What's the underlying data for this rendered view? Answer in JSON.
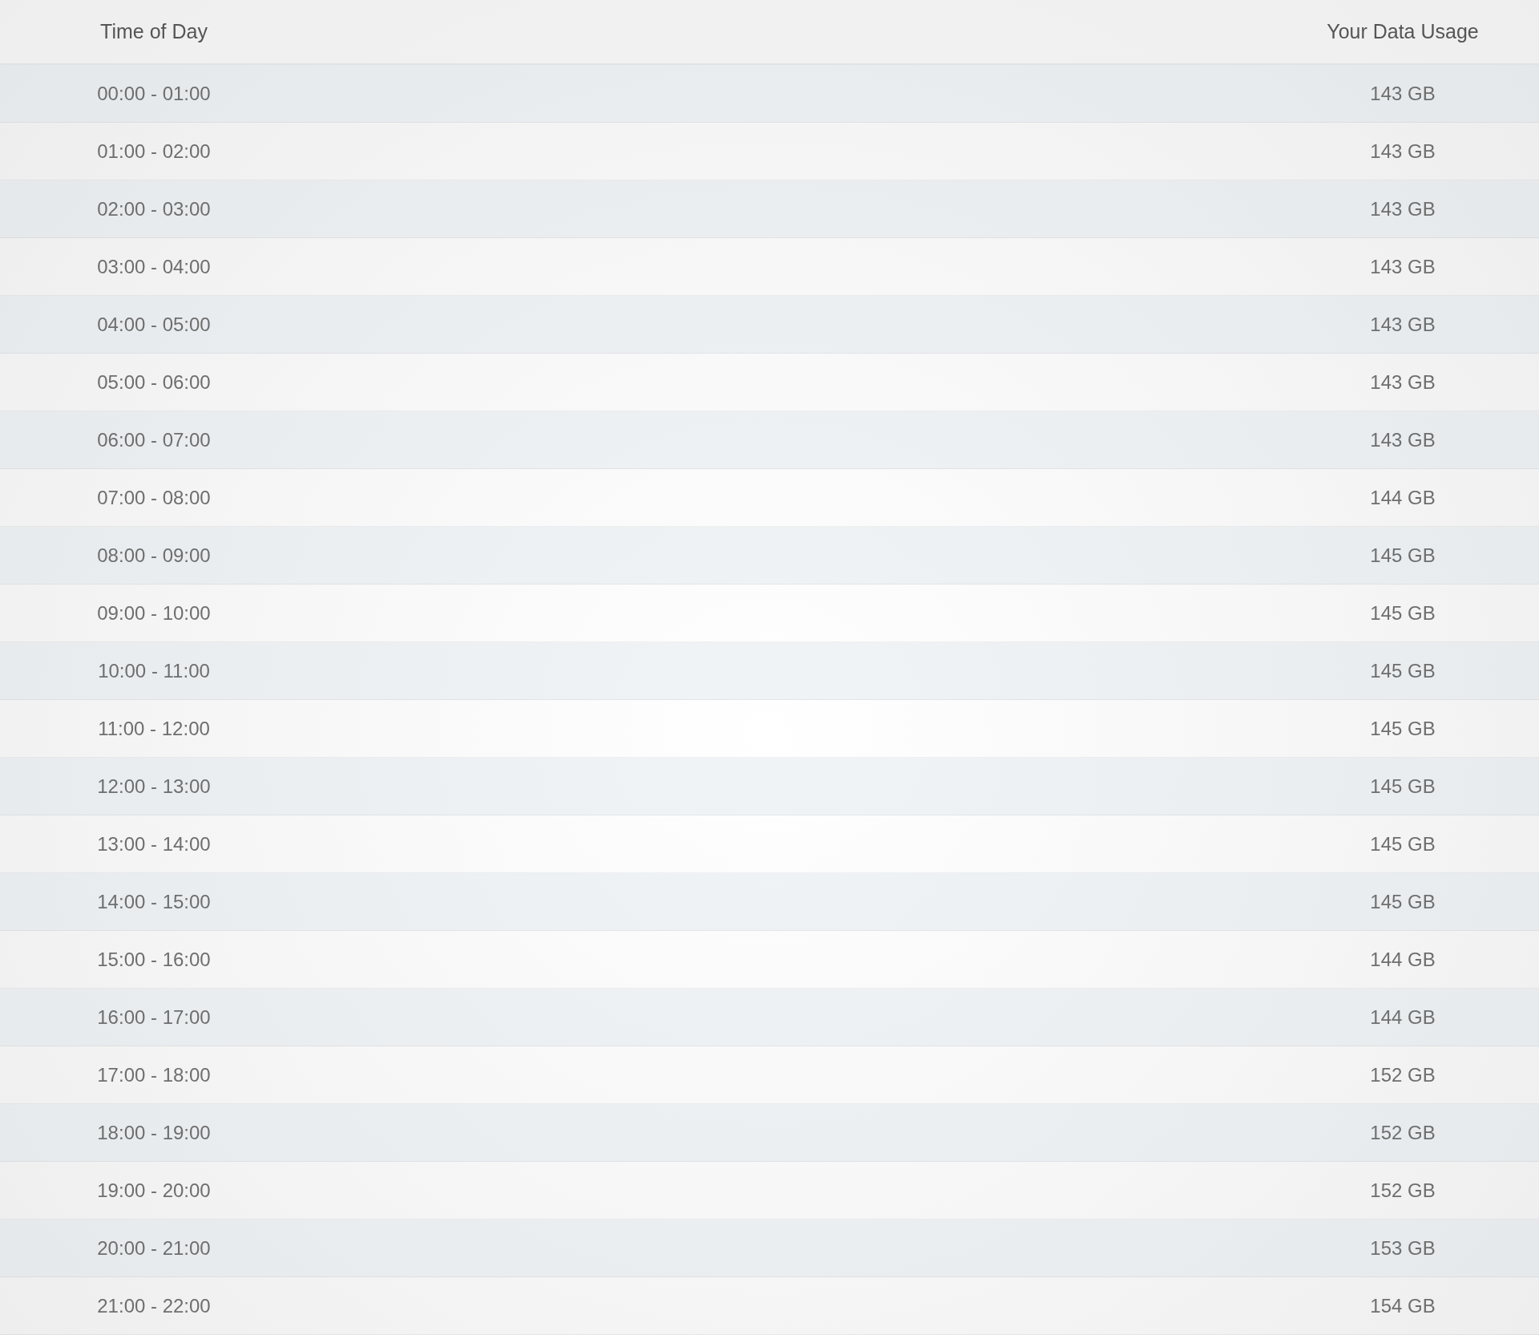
{
  "table": {
    "columns": [
      "Time of Day",
      "Your Data Usage"
    ],
    "rows": [
      {
        "time": "00:00 - 01:00",
        "usage": "143 GB"
      },
      {
        "time": "01:00 - 02:00",
        "usage": "143 GB"
      },
      {
        "time": "02:00 - 03:00",
        "usage": "143 GB"
      },
      {
        "time": "03:00 - 04:00",
        "usage": "143 GB"
      },
      {
        "time": "04:00 - 05:00",
        "usage": "143 GB"
      },
      {
        "time": "05:00 - 06:00",
        "usage": "143 GB"
      },
      {
        "time": "06:00 - 07:00",
        "usage": "143 GB"
      },
      {
        "time": "07:00 - 08:00",
        "usage": "144 GB"
      },
      {
        "time": "08:00 - 09:00",
        "usage": "145 GB"
      },
      {
        "time": "09:00 - 10:00",
        "usage": "145 GB"
      },
      {
        "time": "10:00 - 11:00",
        "usage": "145 GB"
      },
      {
        "time": "11:00 - 12:00",
        "usage": "145 GB"
      },
      {
        "time": "12:00 - 13:00",
        "usage": "145 GB"
      },
      {
        "time": "13:00 - 14:00",
        "usage": "145 GB"
      },
      {
        "time": "14:00 - 15:00",
        "usage": "145 GB"
      },
      {
        "time": "15:00 - 16:00",
        "usage": "144 GB"
      },
      {
        "time": "16:00 - 17:00",
        "usage": "144 GB"
      },
      {
        "time": "17:00 - 18:00",
        "usage": "152 GB"
      },
      {
        "time": "18:00 - 19:00",
        "usage": "152 GB"
      },
      {
        "time": "19:00 - 20:00",
        "usage": "152 GB"
      },
      {
        "time": "20:00 - 21:00",
        "usage": "153 GB"
      },
      {
        "time": "21:00 - 22:00",
        "usage": "154 GB"
      }
    ]
  }
}
